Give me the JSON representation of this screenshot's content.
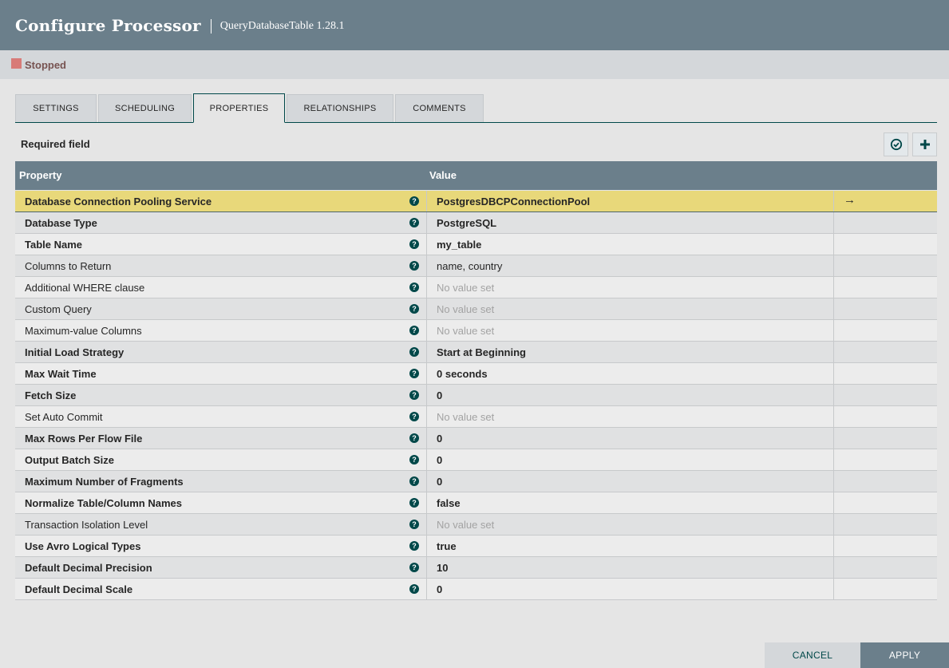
{
  "header": {
    "title": "Configure Processor",
    "subtitle": "QueryDatabaseTable 1.28.1"
  },
  "status": {
    "text": "Stopped",
    "color": "#d87b78"
  },
  "tabs": [
    {
      "label": "SETTINGS",
      "active": false
    },
    {
      "label": "SCHEDULING",
      "active": false
    },
    {
      "label": "PROPERTIES",
      "active": true
    },
    {
      "label": "RELATIONSHIPS",
      "active": false
    },
    {
      "label": "COMMENTS",
      "active": false
    }
  ],
  "toolbar": {
    "required_label": "Required field",
    "verify_icon": "check-circle-icon",
    "add_icon": "plus-icon"
  },
  "table": {
    "headers": {
      "property": "Property",
      "value": "Value"
    },
    "rows": [
      {
        "property": "Database Connection Pooling Service",
        "value": "PostgresDBCPConnectionPool",
        "required": true,
        "set": true,
        "selected": true,
        "goto": "→"
      },
      {
        "property": "Database Type",
        "value": "PostgreSQL",
        "required": true,
        "set": true
      },
      {
        "property": "Table Name",
        "value": "my_table",
        "required": true,
        "set": true
      },
      {
        "property": "Columns to Return",
        "value": "name, country",
        "required": false,
        "set": true
      },
      {
        "property": "Additional WHERE clause",
        "value": "No value set",
        "required": false,
        "set": false
      },
      {
        "property": "Custom Query",
        "value": "No value set",
        "required": false,
        "set": false
      },
      {
        "property": "Maximum-value Columns",
        "value": "No value set",
        "required": false,
        "set": false
      },
      {
        "property": "Initial Load Strategy",
        "value": "Start at Beginning",
        "required": true,
        "set": true
      },
      {
        "property": "Max Wait Time",
        "value": "0 seconds",
        "required": true,
        "set": true
      },
      {
        "property": "Fetch Size",
        "value": "0",
        "required": true,
        "set": true
      },
      {
        "property": "Set Auto Commit",
        "value": "No value set",
        "required": false,
        "set": false
      },
      {
        "property": "Max Rows Per Flow File",
        "value": "0",
        "required": true,
        "set": true
      },
      {
        "property": "Output Batch Size",
        "value": "0",
        "required": true,
        "set": true
      },
      {
        "property": "Maximum Number of Fragments",
        "value": "0",
        "required": true,
        "set": true
      },
      {
        "property": "Normalize Table/Column Names",
        "value": "false",
        "required": true,
        "set": true
      },
      {
        "property": "Transaction Isolation Level",
        "value": "No value set",
        "required": false,
        "set": false
      },
      {
        "property": "Use Avro Logical Types",
        "value": "true",
        "required": true,
        "set": true
      },
      {
        "property": "Default Decimal Precision",
        "value": "10",
        "required": true,
        "set": true
      },
      {
        "property": "Default Decimal Scale",
        "value": "0",
        "required": true,
        "set": true
      }
    ]
  },
  "buttons": {
    "cancel": "CANCEL",
    "apply": "APPLY"
  },
  "colors": {
    "header_bg": "#6b7f8b",
    "accent": "#004849",
    "selected_row": "#e8d87a"
  }
}
